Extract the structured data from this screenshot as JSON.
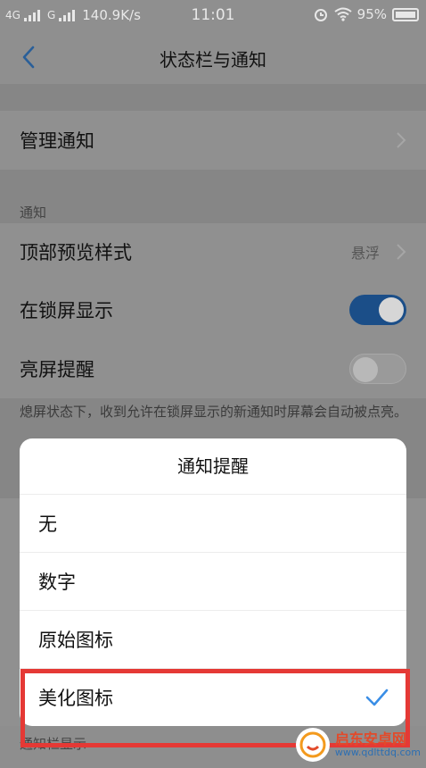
{
  "status_bar": {
    "network1": "4G",
    "network2": "G",
    "speed": "140.9K/s",
    "time": "11:01",
    "battery": "95%"
  },
  "nav": {
    "title": "状态栏与通知"
  },
  "rows": {
    "manage_notifications": "管理通知",
    "section_notifications": "通知",
    "top_preview_style": "顶部预览样式",
    "top_preview_value": "悬浮",
    "show_on_lockscreen": "在锁屏显示",
    "wake_screen": "亮屏提醒",
    "wake_screen_desc": "熄屏状态下，收到允许在锁屏显示的新通知时屏幕会自动被点亮。",
    "notification_bar_display": "通知栏显示"
  },
  "toggles": {
    "show_on_lockscreen": true,
    "wake_screen": false
  },
  "dialog": {
    "title": "通知提醒",
    "options": [
      "无",
      "数字",
      "原始图标",
      "美化图标"
    ],
    "selected": "美化图标"
  },
  "watermark": {
    "name": "启东安卓网",
    "url": "www.qdlttdq.com"
  },
  "colors": {
    "accent": "#3a8ee6",
    "highlight": "#e53935",
    "toggle_on": "#1b4e88"
  }
}
